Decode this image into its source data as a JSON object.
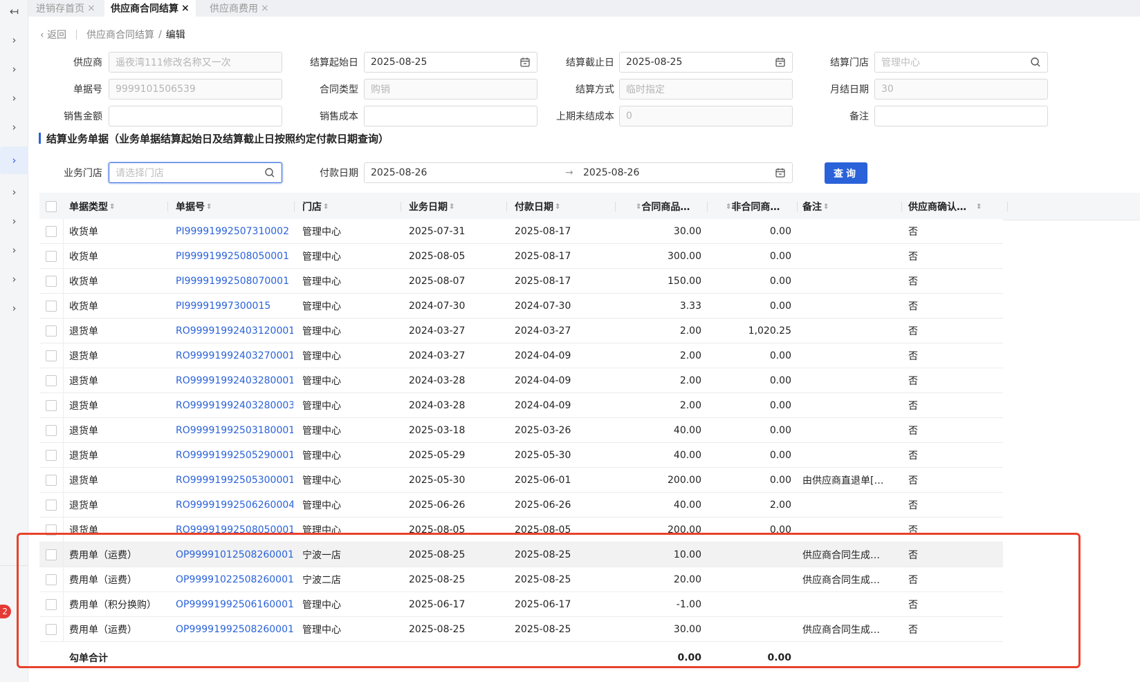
{
  "rail": {
    "collapse_icon": "↤",
    "chevron": "›",
    "badge": "2"
  },
  "tabs": [
    {
      "label": "进销存首页",
      "close": "×"
    },
    {
      "label": "供应商合同结算",
      "close": "×"
    },
    {
      "label": "供应商费用",
      "close": "×"
    }
  ],
  "breadcrumb": {
    "back": "返回",
    "parent": "供应商合同结算",
    "slash": "/",
    "current": "编辑"
  },
  "form": {
    "supplier_label": "供应商",
    "supplier_value": "遥夜湾111修改名称又一次",
    "start_label": "结算起始日",
    "start_value": "2025-08-25",
    "end_label": "结算截止日",
    "end_value": "2025-08-25",
    "store_label": "结算门店",
    "store_placeholder": "管理中心",
    "docno_label": "单据号",
    "docno_value": "9999101506539",
    "contract_label": "合同类型",
    "contract_value": "购销",
    "method_label": "结算方式",
    "method_value": "临时指定",
    "monthly_label": "月结日期",
    "monthly_value": "30",
    "sales_amount_label": "销售金额",
    "sales_amount_value": "",
    "sales_cost_label": "销售成本",
    "sales_cost_value": "",
    "last_cost_label": "上期未结成本",
    "last_cost_value": "0",
    "remark_label": "备注",
    "remark_value": ""
  },
  "section": {
    "title": "结算业务单据（业务单据结算起始日及结算截止日按照约定付款日期查询）"
  },
  "filter": {
    "store_label": "业务门店",
    "store_placeholder": "请选择门店",
    "paydate_label": "付款日期",
    "paydate_from": "2025-08-26",
    "arrow": "→",
    "paydate_to": "2025-08-26",
    "query_button": "查询"
  },
  "table": {
    "columns": [
      "单据类型",
      "单据号",
      "门店",
      "业务日期",
      "付款日期",
      "合同商品…",
      "非合同商…",
      "备注",
      "供应商确认…"
    ],
    "sort_icon": "⇕",
    "rows": [
      {
        "type": "收货单",
        "no": "PI99991992507310002",
        "store": "管理中心",
        "biz_date": "2025-07-31",
        "pay_date": "2025-08-17",
        "contract": "30.00",
        "non_contract": "0.00",
        "remark": "",
        "confirm": "否"
      },
      {
        "type": "收货单",
        "no": "PI99991992508050001",
        "store": "管理中心",
        "biz_date": "2025-08-05",
        "pay_date": "2025-08-17",
        "contract": "300.00",
        "non_contract": "0.00",
        "remark": "",
        "confirm": "否"
      },
      {
        "type": "收货单",
        "no": "PI99991992508070001",
        "store": "管理中心",
        "biz_date": "2025-08-07",
        "pay_date": "2025-08-17",
        "contract": "150.00",
        "non_contract": "0.00",
        "remark": "",
        "confirm": "否"
      },
      {
        "type": "收货单",
        "no": "PI99991997300015",
        "store": "管理中心",
        "biz_date": "2024-07-30",
        "pay_date": "2024-07-30",
        "contract": "3.33",
        "non_contract": "0.00",
        "remark": "",
        "confirm": "否"
      },
      {
        "type": "退货单",
        "no": "RO99991992403120001",
        "store": "管理中心",
        "biz_date": "2024-03-27",
        "pay_date": "2024-03-27",
        "contract": "2.00",
        "non_contract": "1,020.25",
        "remark": "",
        "confirm": "否"
      },
      {
        "type": "退货单",
        "no": "RO99991992403270001",
        "store": "管理中心",
        "biz_date": "2024-03-27",
        "pay_date": "2024-04-09",
        "contract": "2.00",
        "non_contract": "0.00",
        "remark": "",
        "confirm": "否"
      },
      {
        "type": "退货单",
        "no": "RO99991992403280001",
        "store": "管理中心",
        "biz_date": "2024-03-28",
        "pay_date": "2024-04-09",
        "contract": "2.00",
        "non_contract": "0.00",
        "remark": "",
        "confirm": "否"
      },
      {
        "type": "退货单",
        "no": "RO99991992403280003",
        "store": "管理中心",
        "biz_date": "2024-03-28",
        "pay_date": "2024-04-09",
        "contract": "2.00",
        "non_contract": "0.00",
        "remark": "",
        "confirm": "否"
      },
      {
        "type": "退货单",
        "no": "RO99991992503180001",
        "store": "管理中心",
        "biz_date": "2025-03-18",
        "pay_date": "2025-03-26",
        "contract": "40.00",
        "non_contract": "0.00",
        "remark": "",
        "confirm": "否"
      },
      {
        "type": "退货单",
        "no": "RO99991992505290001",
        "store": "管理中心",
        "biz_date": "2025-05-29",
        "pay_date": "2025-05-30",
        "contract": "40.00",
        "non_contract": "0.00",
        "remark": "",
        "confirm": "否"
      },
      {
        "type": "退货单",
        "no": "RO99991992505300001",
        "store": "管理中心",
        "biz_date": "2025-05-30",
        "pay_date": "2025-06-01",
        "contract": "200.00",
        "non_contract": "0.00",
        "remark": "由供应商直退单[…",
        "confirm": "否"
      },
      {
        "type": "退货单",
        "no": "RO99991992506260004",
        "store": "管理中心",
        "biz_date": "2025-06-26",
        "pay_date": "2025-06-26",
        "contract": "40.00",
        "non_contract": "2.00",
        "remark": "",
        "confirm": "否"
      },
      {
        "type": "退货单",
        "no": "RO99991992508050001",
        "store": "管理中心",
        "biz_date": "2025-08-05",
        "pay_date": "2025-08-05",
        "contract": "200.00",
        "non_contract": "0.00",
        "remark": "",
        "confirm": "否"
      },
      {
        "type": "费用单（运费）",
        "no": "OP99991012508260001",
        "store": "宁波一店",
        "biz_date": "2025-08-25",
        "pay_date": "2025-08-25",
        "contract": "10.00",
        "non_contract": "",
        "remark": "供应商合同生成…",
        "confirm": "否"
      },
      {
        "type": "费用单（运费）",
        "no": "OP99991022508260001",
        "store": "宁波二店",
        "biz_date": "2025-08-25",
        "pay_date": "2025-08-25",
        "contract": "20.00",
        "non_contract": "",
        "remark": "供应商合同生成…",
        "confirm": "否"
      },
      {
        "type": "费用单（积分换购）",
        "no": "OP99991992506160001",
        "store": "管理中心",
        "biz_date": "2025-06-17",
        "pay_date": "2025-06-17",
        "contract": "-1.00",
        "non_contract": "",
        "remark": "",
        "confirm": "否"
      },
      {
        "type": "费用单（运费）",
        "no": "OP99991992508260001",
        "store": "管理中心",
        "biz_date": "2025-08-25",
        "pay_date": "2025-08-25",
        "contract": "30.00",
        "non_contract": "",
        "remark": "供应商合同生成…",
        "confirm": "否"
      }
    ],
    "summary": {
      "label": "勾单合计",
      "contract": "0.00",
      "non_contract": "0.00"
    }
  },
  "colors": {
    "accent": "#2a62d9",
    "annotation_box": "#e8412b"
  }
}
